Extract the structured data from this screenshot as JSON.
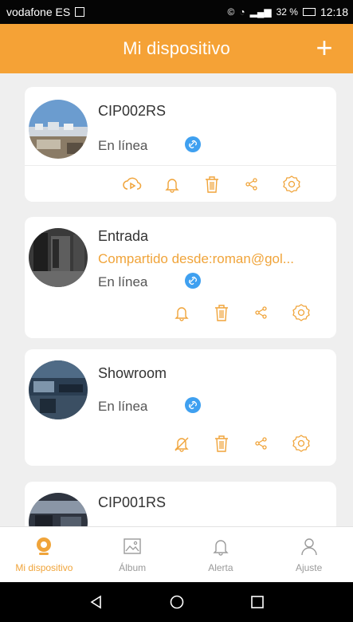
{
  "status_bar": {
    "carrier": "vodafone ES",
    "battery": "32 %",
    "time": "12:18"
  },
  "header": {
    "title": "Mi dispositivo",
    "add_icon": "plus-icon"
  },
  "devices": [
    {
      "name": "CIP002RS",
      "status": "En línea",
      "actions": [
        "cloud-play-icon",
        "bell-icon",
        "trash-icon",
        "share-icon",
        "settings-icon"
      ]
    },
    {
      "name": "Entrada",
      "shared": "Compartido desde:roman@gol...",
      "status": "En línea",
      "actions": [
        "bell-icon",
        "trash-icon",
        "share-icon",
        "settings-icon"
      ]
    },
    {
      "name": "Showroom",
      "status": "En línea",
      "actions": [
        "bell-off-icon",
        "trash-icon",
        "share-icon",
        "settings-icon"
      ]
    },
    {
      "name": "CIP001RS"
    }
  ],
  "tabs": [
    {
      "label": "Mi dispositivo",
      "active": true
    },
    {
      "label": "Álbum"
    },
    {
      "label": "Alerta"
    },
    {
      "label": "Ajuste"
    }
  ],
  "colors": {
    "accent": "#f5a236",
    "icon": "#f0a43a",
    "link_badge": "#3fa0f0"
  }
}
